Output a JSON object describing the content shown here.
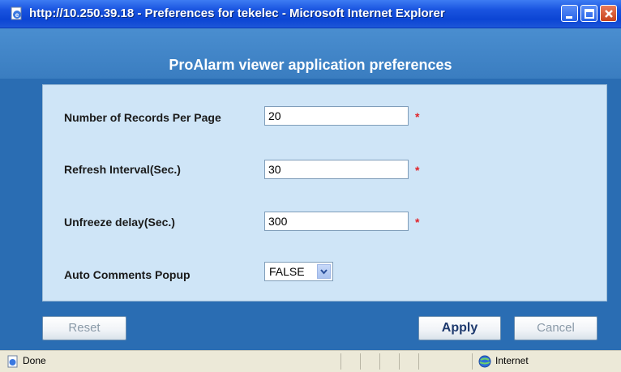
{
  "window": {
    "title": "http://10.250.39.18 - Preferences for tekelec - Microsoft Internet Explorer"
  },
  "page": {
    "heading": "ProAlarm viewer application preferences"
  },
  "form": {
    "records_label": "Number of Records Per Page",
    "records_value": "20",
    "refresh_label": "Refresh Interval(Sec.)",
    "refresh_value": "30",
    "unfreeze_label": "Unfreeze delay(Sec.)",
    "unfreeze_value": "300",
    "popup_label": "Auto Comments Popup",
    "popup_value": "FALSE",
    "required_marker": "*"
  },
  "buttons": {
    "reset": "Reset",
    "apply": "Apply",
    "cancel": "Cancel"
  },
  "status": {
    "text": "Done",
    "zone": "Internet"
  },
  "colors": {
    "frame": "#2a6db3",
    "panel": "#cfe5f7",
    "required": "#e0242a"
  },
  "icons": [
    "ie-page-icon",
    "minimize-icon",
    "maximize-icon",
    "close-icon",
    "chevron-down-icon",
    "done-page-icon",
    "globe-icon"
  ]
}
